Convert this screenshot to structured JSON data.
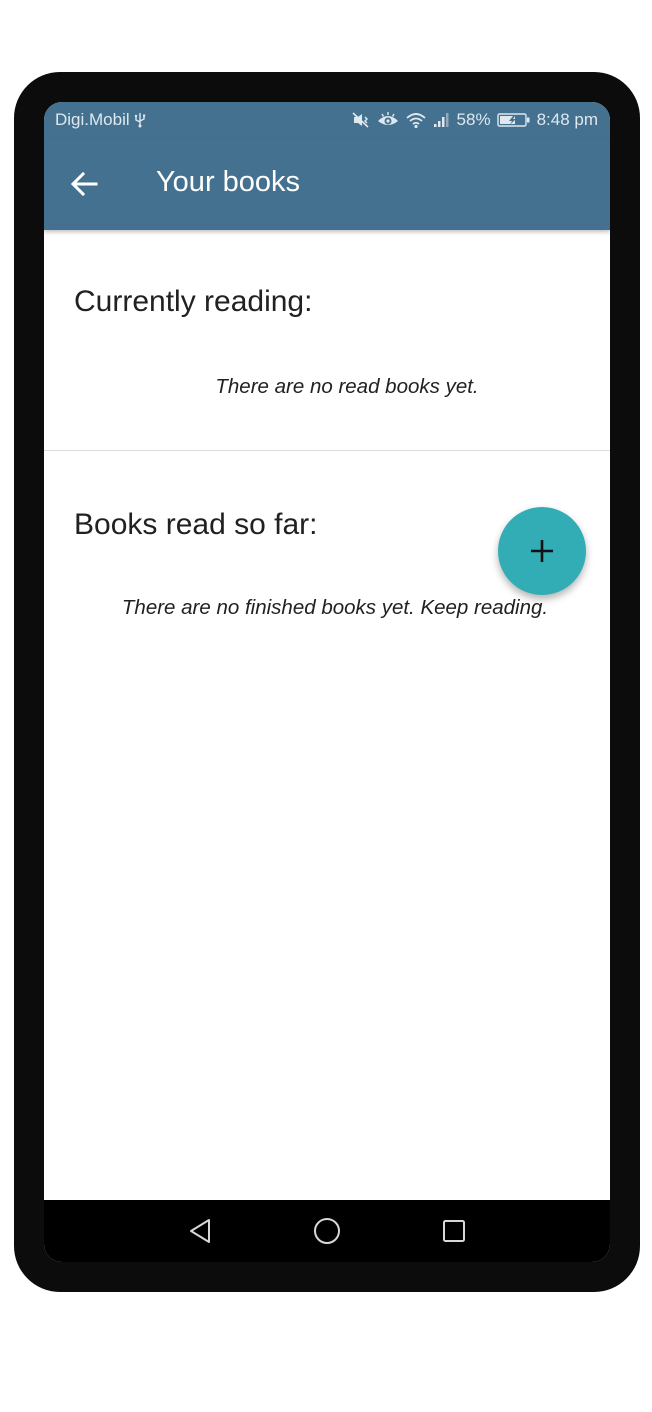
{
  "status_bar": {
    "carrier": "Digi.Mobil",
    "usb_icon": "usb-icon",
    "battery_percent": "58%",
    "time": "8:48 pm",
    "icons": [
      "mute-vibrate-icon",
      "eye-comfort-icon",
      "wifi-icon",
      "signal-icon",
      "battery-charging-icon"
    ]
  },
  "app_bar": {
    "title": "Your books",
    "back_icon": "arrow-back-icon"
  },
  "currently_reading": {
    "title": "Currently reading:",
    "empty_message": "There are no read books yet."
  },
  "books_read": {
    "title": "Books read so far:",
    "empty_message": "There are no finished books yet. Keep reading."
  },
  "fab": {
    "icon": "plus-icon"
  },
  "nav_bar": {
    "icons": [
      "back-triangle-icon",
      "home-circle-icon",
      "recents-square-icon"
    ]
  },
  "colors": {
    "app_bar": "#44718f",
    "fab": "#33adb5",
    "text": "#212121"
  }
}
